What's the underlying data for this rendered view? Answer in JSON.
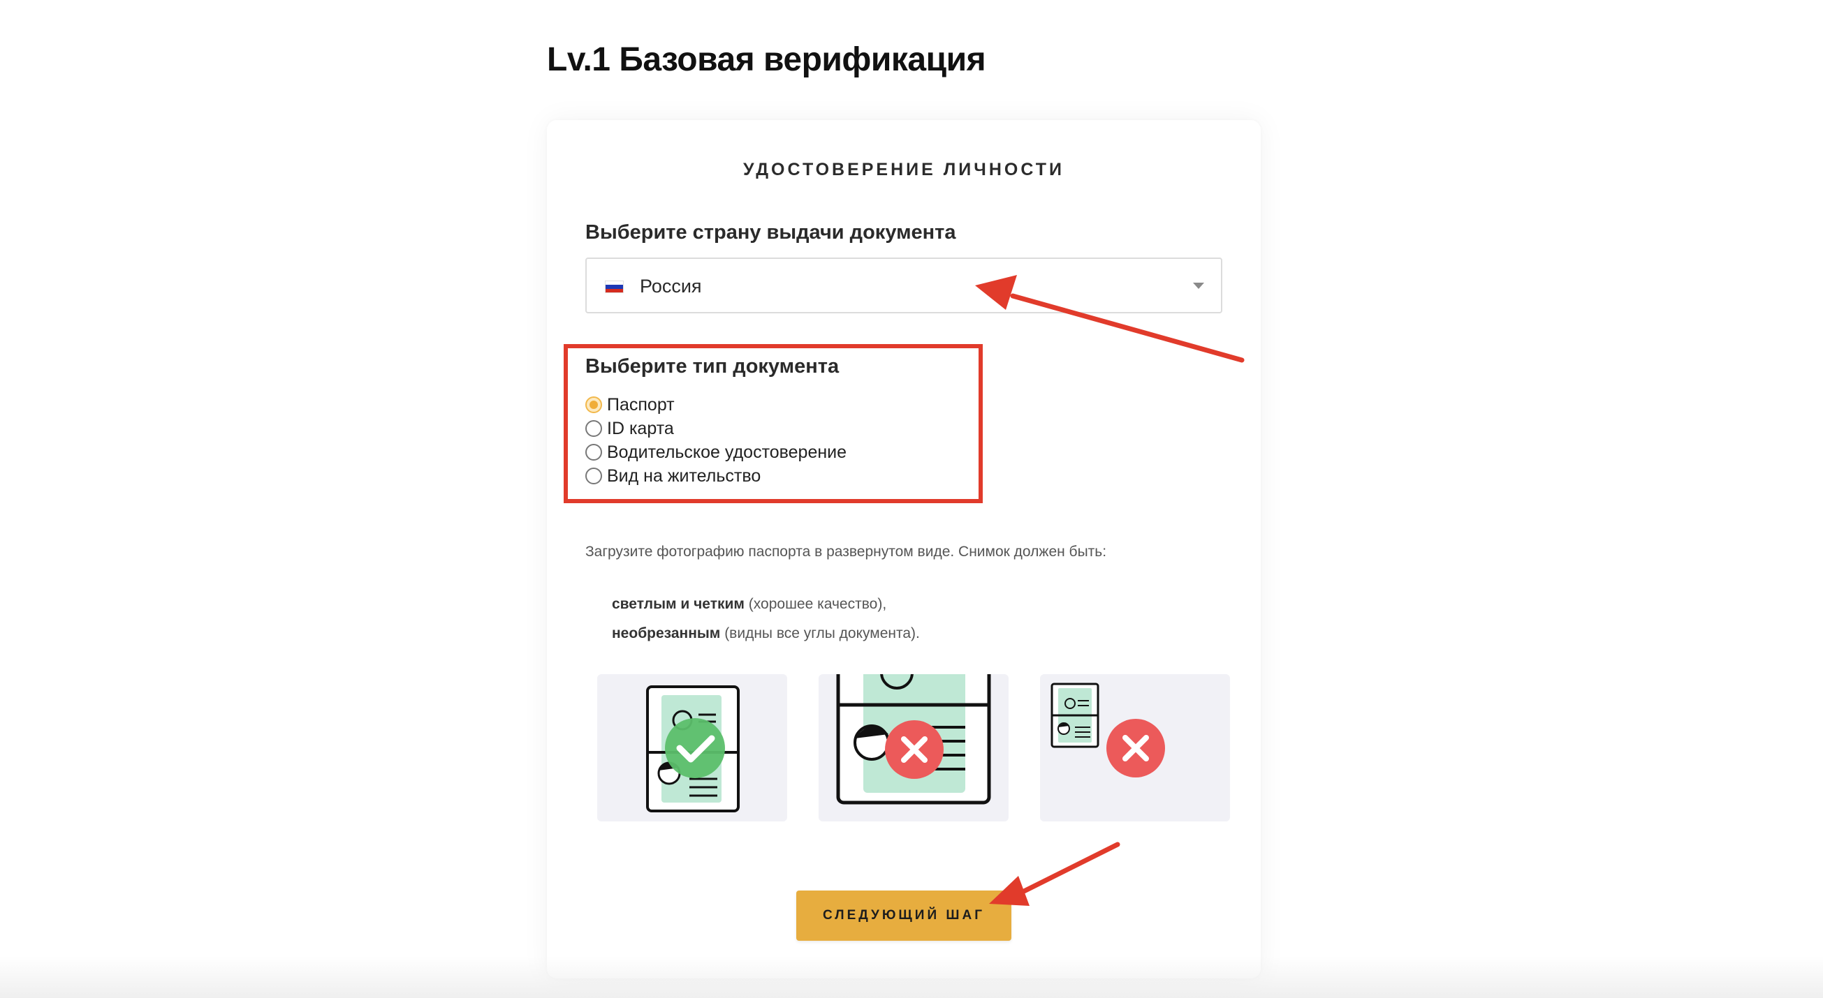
{
  "page": {
    "title": "Lv.1 Базовая верификация"
  },
  "card": {
    "heading": "УДОСТОВЕРЕНИЕ ЛИЧНОСТИ",
    "country_label": "Выберите страну выдачи документа",
    "country": {
      "value": "Россия",
      "flag_icon": "russia-flag-icon"
    },
    "doc_type_label": "Выберите тип документа",
    "doc_types": [
      {
        "label": "Паспорт",
        "checked": true
      },
      {
        "label": "ID карта",
        "checked": false
      },
      {
        "label": "Водительское удостоверение",
        "checked": false
      },
      {
        "label": "Вид на жительство",
        "checked": false
      }
    ],
    "instructions": "Загрузите фотографию паспорта в развернутом виде. Снимок должен быть:",
    "requirements": [
      {
        "bold": "светлым и четким",
        "rest": " (хорошее качество),"
      },
      {
        "bold": "необрезанным",
        "rest": " (видны все углы документа)."
      }
    ],
    "examples": [
      {
        "name": "example-good",
        "icon": "check-icon",
        "status": "correct"
      },
      {
        "name": "example-cropped",
        "icon": "cross-icon",
        "status": "incorrect"
      },
      {
        "name": "example-too-small",
        "icon": "cross-icon",
        "status": "incorrect"
      }
    ],
    "next_button": "СЛЕДУЮЩИЙ ШАГ"
  },
  "colors": {
    "accent": "#e7ad3f",
    "annotation": "#e13b2b",
    "success": "#5cbf6c",
    "error": "#ec5a5a",
    "document_fill": "#bfe8d5"
  }
}
